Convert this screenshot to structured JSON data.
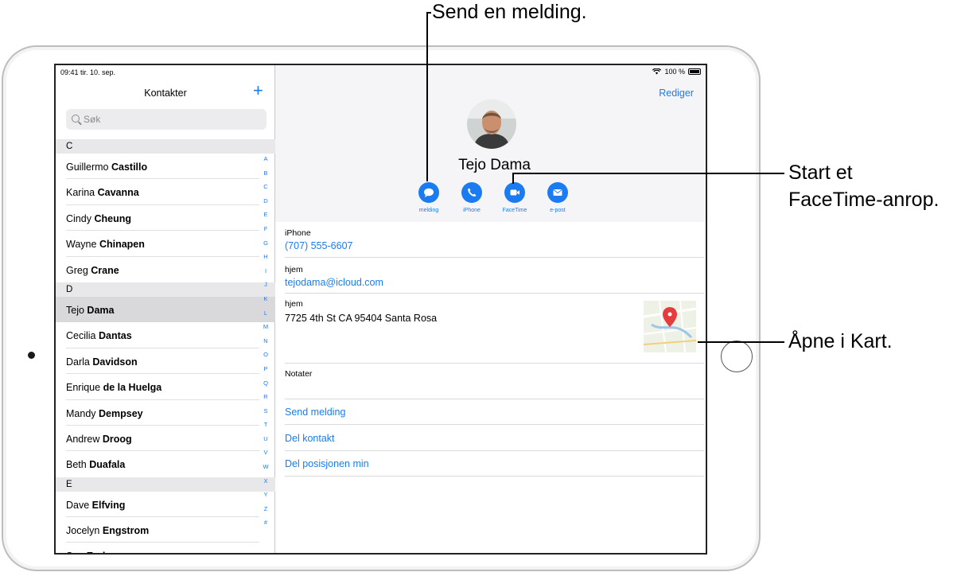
{
  "status_bar": {
    "time_date": "09:41  tir. 10. sep.",
    "battery": "100 %"
  },
  "sidebar": {
    "title": "Kontakter",
    "add_label": "+",
    "search_placeholder": "Søk",
    "sections": [
      {
        "letter": "C",
        "contacts": [
          {
            "first": "Guillermo",
            "last": "Castillo"
          },
          {
            "first": "Karina",
            "last": "Cavanna"
          },
          {
            "first": "Cindy",
            "last": "Cheung"
          },
          {
            "first": "Wayne",
            "last": "Chinapen"
          },
          {
            "first": "Greg",
            "last": "Crane"
          }
        ]
      },
      {
        "letter": "D",
        "contacts": [
          {
            "first": "Tejo",
            "last": "Dama",
            "selected": true
          },
          {
            "first": "Cecilia",
            "last": "Dantas"
          },
          {
            "first": "Darla",
            "last": "Davidson"
          },
          {
            "first": "Enrique",
            "last": "de la Huelga"
          },
          {
            "first": "Mandy",
            "last": "Dempsey"
          },
          {
            "first": "Andrew",
            "last": "Droog"
          },
          {
            "first": "Beth",
            "last": "Duafala"
          }
        ]
      },
      {
        "letter": "E",
        "contacts": [
          {
            "first": "Dave",
            "last": "Elfving"
          },
          {
            "first": "Jocelyn",
            "last": "Engstrom"
          },
          {
            "first": "Sue",
            "last": "Erskon"
          }
        ]
      }
    ],
    "index_letters": [
      "A",
      "B",
      "C",
      "D",
      "E",
      "F",
      "G",
      "H",
      "I",
      "J",
      "K",
      "L",
      "M",
      "N",
      "O",
      "P",
      "Q",
      "R",
      "S",
      "T",
      "U",
      "V",
      "W",
      "X",
      "Y",
      "Z",
      "#"
    ]
  },
  "detail": {
    "edit_label": "Rediger",
    "name": "Tejo Dama",
    "actions": [
      {
        "id": "message",
        "label": "melding",
        "icon": "message-icon"
      },
      {
        "id": "phone",
        "label": "iPhone",
        "icon": "phone-icon"
      },
      {
        "id": "facetime",
        "label": "FaceTime",
        "icon": "video-icon"
      },
      {
        "id": "email",
        "label": "e-post",
        "icon": "mail-icon"
      }
    ],
    "phone": {
      "label": "iPhone",
      "value": "(707) 555-6607"
    },
    "email": {
      "label": "hjem",
      "value": "tejodama@icloud.com"
    },
    "address": {
      "label": "hjem",
      "value": "7725 4th St CA 95404 Santa Rosa"
    },
    "notes_label": "Notater",
    "links": [
      "Send melding",
      "Del kontakt",
      "Del posisjonen min"
    ]
  },
  "callouts": {
    "message": "Send en melding.",
    "facetime_line1": "Start et",
    "facetime_line2": "FaceTime-anrop.",
    "maps": "Åpne i Kart."
  },
  "colors": {
    "accent": "#1a7cf0",
    "section_bg": "#e8e8ea",
    "selected_bg": "#d9d9dc",
    "header_bg": "#f5f5f8"
  }
}
